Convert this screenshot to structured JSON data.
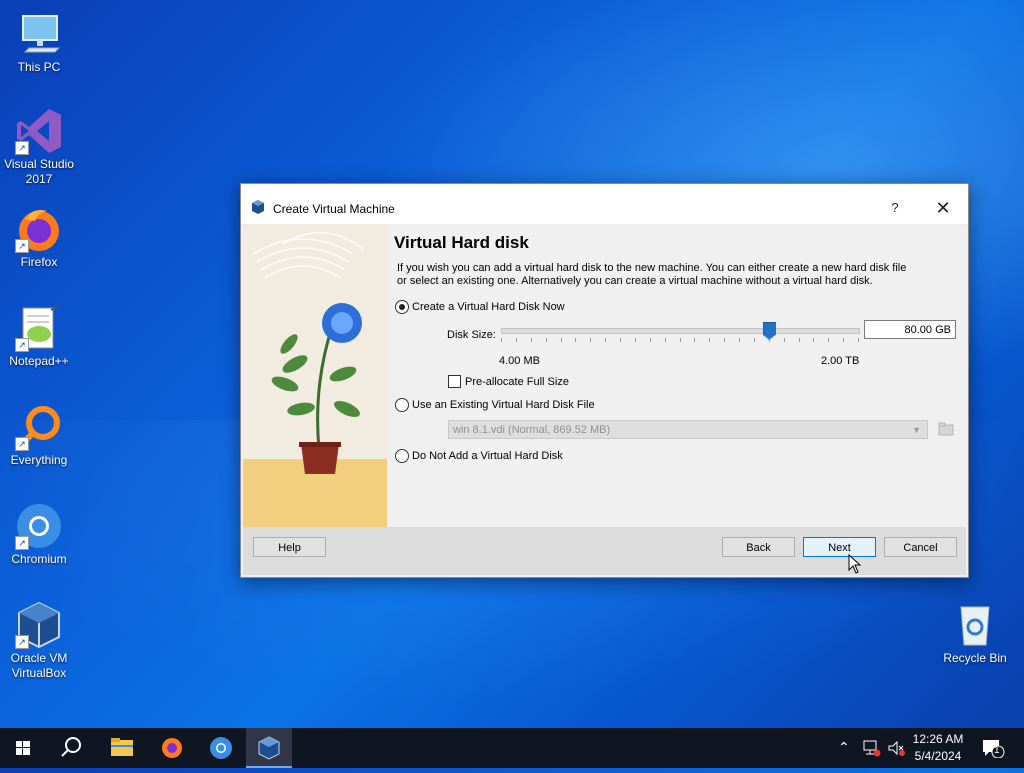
{
  "desktop": {
    "icons": [
      {
        "label": "This PC"
      },
      {
        "label": "Visual Studio 2017"
      },
      {
        "label": "Firefox"
      },
      {
        "label": "Notepad++"
      },
      {
        "label": "Everything"
      },
      {
        "label": "Chromium"
      },
      {
        "label": "Oracle VM VirtualBox"
      },
      {
        "label": "Recycle Bin"
      }
    ]
  },
  "dialog": {
    "title": "Create Virtual Machine",
    "help_symbol": "?",
    "close_symbol": "✕",
    "section_title": "Virtual Hard disk",
    "description": "If you wish you can add a virtual hard disk to the new machine. You can either create a new hard disk file or select an existing one. Alternatively you can create a virtual machine without a virtual hard disk.",
    "option_create": "Create a Virtual Hard Disk Now",
    "disk_size_label": "Disk Size:",
    "disk_size_value": "80.00 GB",
    "slider_min": "4.00 MB",
    "slider_max": "2.00 TB",
    "slider_position": 0.75,
    "preallocate_label": "Pre-allocate Full Size",
    "option_existing": "Use an Existing Virtual Hard Disk File",
    "existing_file": "win 8.1.vdi (Normal, 869.52 MB)",
    "option_none": "Do Not Add a Virtual Hard Disk",
    "buttons": {
      "help": "Help",
      "back": "Back",
      "next": "Next",
      "cancel": "Cancel"
    }
  },
  "taskbar": {
    "time": "12:26 AM",
    "date": "5/4/2024",
    "notification_count": "1"
  }
}
